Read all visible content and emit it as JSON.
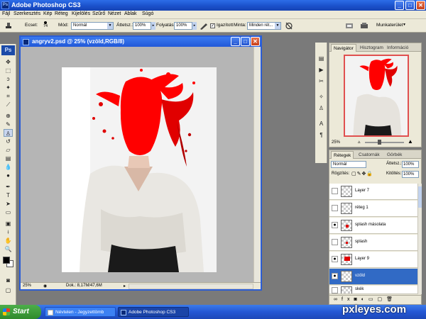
{
  "app": {
    "title": "Adobe Photoshop CS3",
    "icon": "ps-icon"
  },
  "menu": [
    "Fájl",
    "Szerkesztés",
    "Kép",
    "Réteg",
    "Kijelölés",
    "Szűrő",
    "Nézet",
    "Ablak",
    "Súgó"
  ],
  "options": {
    "brush_label": "Ecset:",
    "brush_size": "74",
    "mode_label": "Mód:",
    "mode_value": "Normál",
    "opacity_label": "Áttetsz.:",
    "opacity_value": "100%",
    "flow_label": "Folyatás:",
    "flow_value": "100%",
    "align_label": "Igazított",
    "sample_label": "Minta:",
    "sample_value": "Minden rét...",
    "workspace_label": "Munkaterület"
  },
  "document": {
    "title": "angryv2.psd @ 25% (vzöld,RGB/8)",
    "zoom": "25%",
    "doc_info": "Dok.: 8,17M/47,6M"
  },
  "navigator": {
    "tabs": [
      "Navigátor",
      "Hisztogram",
      "Információ"
    ],
    "zoom": "25%"
  },
  "layers_panel": {
    "tabs": [
      "Rétegek",
      "Csatornák",
      "Görbék"
    ],
    "blend_mode": "Normál",
    "opacity_label": "Áttetsz.:",
    "opacity_value": "100%",
    "lock_label": "Rögzítés:",
    "fill_label": "Kitöltés:",
    "fill_value": "100%",
    "layers": [
      {
        "name": "Layer 7",
        "visible": false
      },
      {
        "name": "réteg 1",
        "visible": false
      },
      {
        "name": "splash másolata",
        "visible": true
      },
      {
        "name": "splash",
        "visible": false
      },
      {
        "name": "Layer 9",
        "visible": true
      },
      {
        "name": "vzöld",
        "visible": true,
        "selected": true
      },
      {
        "name": "skék",
        "visible": false
      }
    ]
  },
  "taskbar": {
    "start": "Start",
    "items": [
      "Névtelen - Jegyzettömb",
      "Adobe Photoshop CS3"
    ]
  },
  "watermark": "pxleyes.com",
  "colors": {
    "accent": "#2b5dd6",
    "splash": "#ff0000",
    "selected_layer": "#316ac5"
  }
}
